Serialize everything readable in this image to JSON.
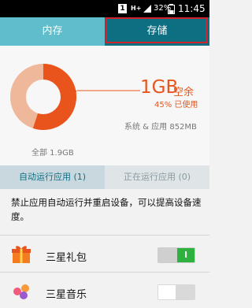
{
  "status_bar": {
    "notification_badge": "1",
    "network_type": "H+",
    "battery_percent": "32%",
    "time": "11:45"
  },
  "tabs": [
    {
      "label": "内存",
      "active": false
    },
    {
      "label": "存储",
      "active": true
    }
  ],
  "storage": {
    "free_amount": "1GB",
    "free_label": "空余",
    "used_percent_text": "45% 已使用",
    "used_fraction": 0.45,
    "system_apps": "系统 & 应用 852MB",
    "total": "全部 1.9GB"
  },
  "sub_tabs": [
    {
      "label": "自动运行应用 (1)",
      "active": true
    },
    {
      "label": "正在运行应用 (0)",
      "active": false
    }
  ],
  "description": "禁止应用自动运行并重启设备，可以提高设备速度。",
  "apps": [
    {
      "name": "三星礼包",
      "toggle": "on",
      "toggle_label": "I"
    },
    {
      "name": "三星音乐",
      "toggle": "off",
      "toggle_label": ""
    }
  ],
  "colors": {
    "accent_orange": "#e8541b",
    "donut_light": "#f0b89a",
    "tab_bg": "#5fbdcc",
    "tab_active": "#0f6f82",
    "toggle_on": "#2fb13f"
  }
}
